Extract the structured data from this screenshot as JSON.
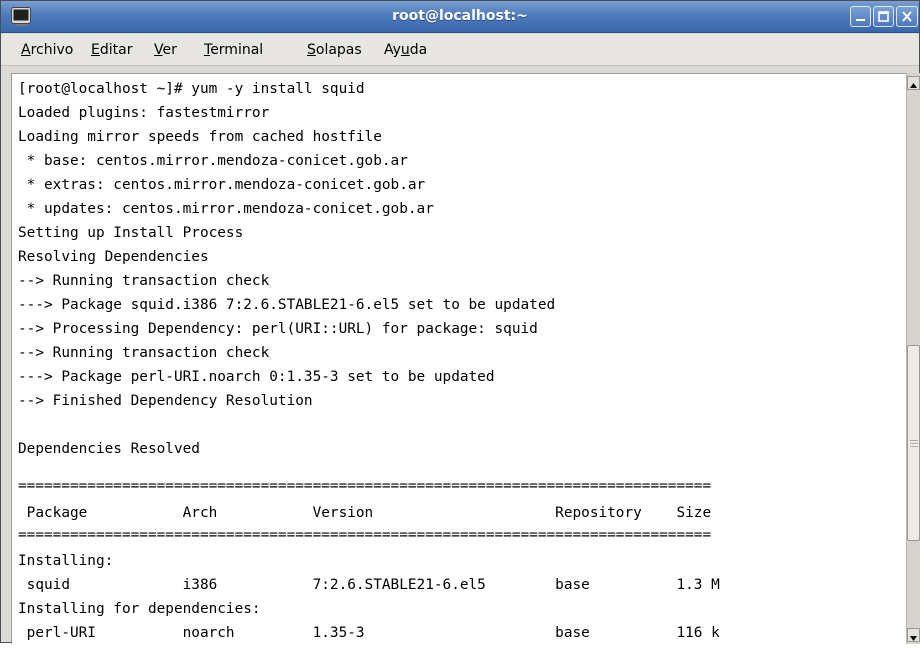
{
  "window": {
    "title": "root@localhost:~"
  },
  "menu": [
    {
      "mnemonic": "A",
      "rest": "rchivo"
    },
    {
      "mnemonic": "E",
      "rest": "ditar"
    },
    {
      "mnemonic": "V",
      "rest": "er"
    },
    {
      "mnemonic": "T",
      "rest": "erminal"
    },
    {
      "mnemonic": "S",
      "rest": "olapas"
    },
    {
      "prefix": "Ay",
      "mnemonic": "u",
      "rest": "da"
    }
  ],
  "terminal": {
    "lines": [
      "[root@localhost ~]# yum -y install squid",
      "Loaded plugins: fastestmirror",
      "Loading mirror speeds from cached hostfile",
      " * base: centos.mirror.mendoza-conicet.gob.ar",
      " * extras: centos.mirror.mendoza-conicet.gob.ar",
      " * updates: centos.mirror.mendoza-conicet.gob.ar",
      "Setting up Install Process",
      "Resolving Dependencies",
      "--> Running transaction check",
      "---> Package squid.i386 7:2.6.STABLE21-6.el5 set to be updated",
      "--> Processing Dependency: perl(URI::URL) for package: squid",
      "--> Running transaction check",
      "---> Package perl-URI.noarch 0:1.35-3 set to be updated",
      "--> Finished Dependency Resolution",
      "",
      "Dependencies Resolved",
      "",
      "================================================================================",
      " Package           Arch           Version                     Repository    Size",
      "================================================================================",
      "Installing:",
      " squid             i386           7:2.6.STABLE21-6.el5        base          1.3 M",
      "Installing for dependencies:",
      " perl-URI          noarch         1.35-3                      base          116 k"
    ]
  },
  "colors": {
    "titlebar": "#4f7bbd",
    "terminal_bg": "#ffffff",
    "terminal_fg": "#000000"
  }
}
